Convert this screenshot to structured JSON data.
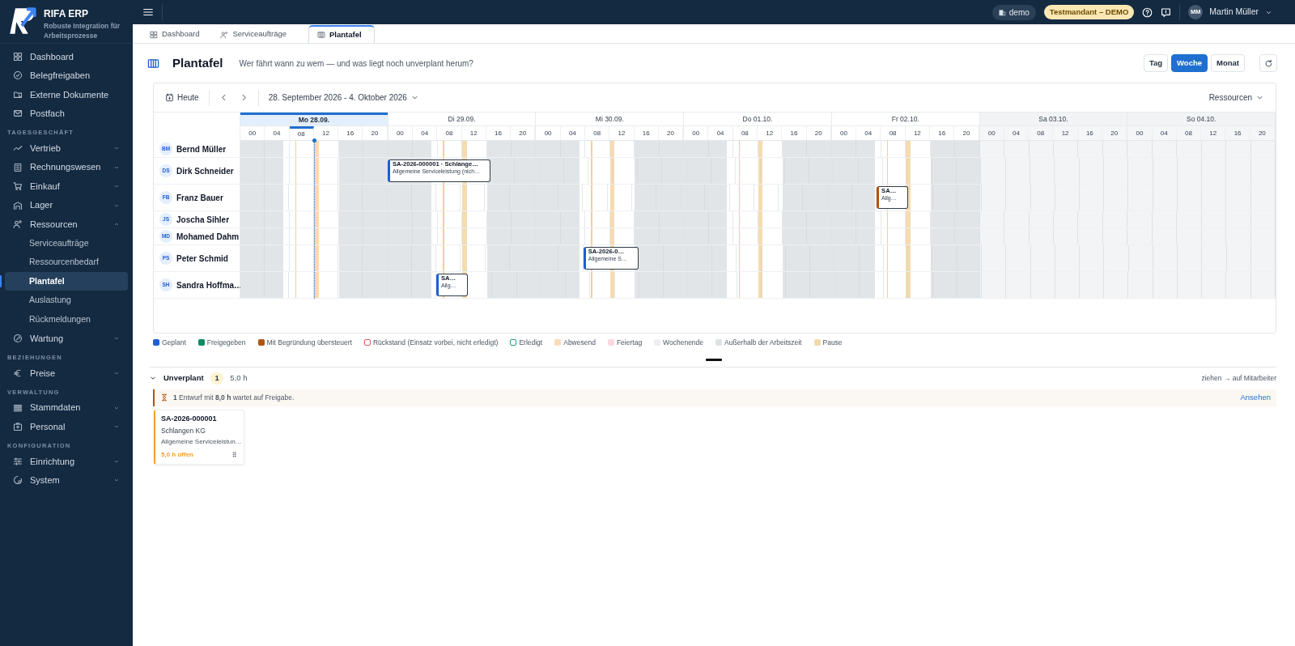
{
  "app": {
    "name": "RIFA ERP",
    "tagline": "Robuste Integration für Arbeitsprozesse"
  },
  "sidebar": {
    "sections": [
      {
        "items": [
          {
            "label": "Dashboard",
            "selected": false
          },
          {
            "label": "Belegfreigaben",
            "selected": false
          },
          {
            "label": "Externe Dokumente",
            "selected": false
          },
          {
            "label": "Postfach",
            "selected": false
          }
        ]
      },
      {
        "heading": "TAGESGESCHÄFT",
        "items": [
          {
            "label": "Vertrieb",
            "selected": false,
            "expanded": false
          },
          {
            "label": "Rechnungswesen",
            "selected": false,
            "expanded": false
          },
          {
            "label": "Einkauf",
            "selected": false,
            "expanded": false
          },
          {
            "label": "Lager",
            "selected": false,
            "expanded": false
          },
          {
            "label": "Ressourcen",
            "selected": false,
            "expanded": true,
            "children": [
              {
                "label": "Serviceaufträge",
                "selected": false
              },
              {
                "label": "Ressourcenbedarf",
                "selected": false
              },
              {
                "label": "Plantafel",
                "selected": true
              },
              {
                "label": "Auslastung",
                "selected": false
              },
              {
                "label": "Rückmeldungen",
                "selected": false
              }
            ]
          },
          {
            "label": "Wartung",
            "selected": false,
            "expanded": false
          }
        ]
      },
      {
        "heading": "BEZIEHUNGEN",
        "items": [
          {
            "label": "Preise",
            "selected": false,
            "expanded": false
          }
        ]
      },
      {
        "heading": "VERWALTUNG",
        "items": [
          {
            "label": "Stammdaten",
            "selected": false,
            "expanded": false
          },
          {
            "label": "Personal",
            "selected": false,
            "expanded": false
          }
        ]
      },
      {
        "heading": "KONFIGURATION",
        "items": [
          {
            "label": "Einrichtung",
            "selected": false,
            "expanded": false
          },
          {
            "label": "System",
            "selected": false,
            "expanded": false
          }
        ]
      }
    ]
  },
  "topbar": {
    "workspace": "demo",
    "tenant": "Testmandant – DEMO",
    "user": {
      "initials": "MM",
      "name": "Martin Müller"
    }
  },
  "tabs": [
    {
      "label": "Dashboard",
      "selected": false
    },
    {
      "label": "Serviceaufträge",
      "selected": false
    },
    {
      "label": "Plantafel",
      "selected": true
    }
  ],
  "page": {
    "title": "Plantafel",
    "subtitle": "Wer fährt wann zu wem — und was liegt noch unverplant herum?",
    "views": [
      {
        "label": "Tag",
        "selected": false
      },
      {
        "label": "Woche",
        "selected": true
      },
      {
        "label": "Monat",
        "selected": false
      }
    ]
  },
  "planner": {
    "today_button": "Heute",
    "range": "28. September 2026 - 4. Oktober 2026",
    "resources_menu": "Ressourcen",
    "days": [
      {
        "label": "Mo 28.09.",
        "kind": "workday",
        "today": true,
        "hours": [
          {
            "label": "00",
            "current": false
          },
          {
            "label": "04",
            "current": false
          },
          {
            "label": "08",
            "current": true
          },
          {
            "label": "12",
            "current": false
          },
          {
            "label": "16",
            "current": false
          },
          {
            "label": "20",
            "current": false
          }
        ]
      },
      {
        "label": "Di 29.09.",
        "kind": "workday",
        "today": false,
        "hours": [
          {
            "label": "00",
            "current": false
          },
          {
            "label": "04",
            "current": false
          },
          {
            "label": "08",
            "current": false
          },
          {
            "label": "12",
            "current": false
          },
          {
            "label": "16",
            "current": false
          },
          {
            "label": "20",
            "current": false
          }
        ]
      },
      {
        "label": "Mi 30.09.",
        "kind": "workday",
        "today": false,
        "hours": [
          {
            "label": "00",
            "current": false
          },
          {
            "label": "04",
            "current": false
          },
          {
            "label": "08",
            "current": false
          },
          {
            "label": "12",
            "current": false
          },
          {
            "label": "16",
            "current": false
          },
          {
            "label": "20",
            "current": false
          }
        ]
      },
      {
        "label": "Do 01.10.",
        "kind": "workday",
        "today": false,
        "hours": [
          {
            "label": "00",
            "current": false
          },
          {
            "label": "04",
            "current": false
          },
          {
            "label": "08",
            "current": false
          },
          {
            "label": "12",
            "current": false
          },
          {
            "label": "16",
            "current": false
          },
          {
            "label": "20",
            "current": false
          }
        ]
      },
      {
        "label": "Fr 02.10.",
        "kind": "workday",
        "today": false,
        "hours": [
          {
            "label": "00",
            "current": false
          },
          {
            "label": "04",
            "current": false
          },
          {
            "label": "08",
            "current": false
          },
          {
            "label": "12",
            "current": false
          },
          {
            "label": "16",
            "current": false
          },
          {
            "label": "20",
            "current": false
          }
        ]
      },
      {
        "label": "Sa 03.10.",
        "kind": "weekend",
        "today": false,
        "hours": [
          {
            "label": "00",
            "current": false
          },
          {
            "label": "04",
            "current": false
          },
          {
            "label": "08",
            "current": false
          },
          {
            "label": "12",
            "current": false
          },
          {
            "label": "16",
            "current": false
          },
          {
            "label": "20",
            "current": false
          }
        ]
      },
      {
        "label": "So 04.10.",
        "kind": "weekend",
        "today": false,
        "hours": [
          {
            "label": "00",
            "current": false
          },
          {
            "label": "04",
            "current": false
          },
          {
            "label": "08",
            "current": false
          },
          {
            "label": "12",
            "current": false
          },
          {
            "label": "16",
            "current": false
          },
          {
            "label": "20",
            "current": false
          }
        ]
      }
    ],
    "resources": [
      {
        "initials": "BM",
        "name": "Bernd Müller"
      },
      {
        "initials": "DS",
        "name": "Dirk Schneider",
        "events": [
          {
            "title": "SA-2026-000001 · Schlange…",
            "subtitle": "Allgemeine Serviceleistung (nich…",
            "kind": "planned",
            "slots": [
              false,
              false,
              false,
              false,
              false,
              false,
              true,
              true,
              true,
              true,
              false,
              false,
              false,
              false,
              false,
              false,
              false,
              false,
              false,
              false,
              false,
              false,
              false,
              false,
              false,
              false,
              false,
              false,
              false,
              false,
              false,
              false,
              false,
              false,
              false,
              false,
              false,
              false,
              false,
              false,
              false,
              false
            ]
          }
        ]
      },
      {
        "initials": "FB",
        "name": "Franz Bauer",
        "events": [
          {
            "title": "SA…",
            "subtitle": "Allg…",
            "kind": "overridden",
            "slots": [
              false,
              false,
              false,
              false,
              false,
              false,
              false,
              false,
              false,
              false,
              false,
              false,
              false,
              false,
              false,
              false,
              false,
              false,
              false,
              false,
              false,
              false,
              false,
              false,
              false,
              false,
              true,
              false,
              false,
              false,
              false,
              false,
              false,
              false,
              false,
              false,
              false,
              false,
              false,
              false,
              false,
              false
            ]
          }
        ]
      },
      {
        "initials": "JS",
        "name": "Joscha Sihler"
      },
      {
        "initials": "MD",
        "name": "Mohamed Dahm"
      },
      {
        "initials": "PS",
        "name": "Peter Schmid",
        "events": [
          {
            "title": "SA-2026-0…",
            "subtitle": "Allgemeine S…",
            "kind": "planned",
            "slots": [
              false,
              false,
              false,
              false,
              false,
              false,
              false,
              false,
              false,
              false,
              false,
              false,
              false,
              false,
              true,
              true,
              false,
              false,
              false,
              false,
              false,
              false,
              false,
              false,
              false,
              false,
              false,
              false,
              false,
              false,
              false,
              false,
              false,
              false,
              false,
              false,
              false,
              false,
              false,
              false,
              false,
              false
            ]
          }
        ]
      },
      {
        "initials": "SH",
        "name": "Sandra Hoffma…",
        "events": [
          {
            "title": "SA…",
            "subtitle": "Allg…",
            "kind": "planned",
            "slots": [
              false,
              false,
              false,
              false,
              false,
              false,
              false,
              false,
              true,
              false,
              false,
              false,
              false,
              false,
              false,
              false,
              false,
              false,
              false,
              false,
              false,
              false,
              false,
              false,
              false,
              false,
              false,
              false,
              false,
              false,
              false,
              false,
              false,
              false,
              false,
              false,
              false,
              false,
              false,
              false,
              false,
              false
            ]
          }
        ]
      }
    ]
  },
  "legend": [
    {
      "label": "Geplant",
      "color": "#1d5fd3",
      "kind": "filled"
    },
    {
      "label": "Freigegeben",
      "color": "#0e8a62",
      "kind": "filled"
    },
    {
      "label": "Mit Begründung übersteuert",
      "color": "#b4530f",
      "kind": "filled"
    },
    {
      "label": "Rückstand (Einsatz vorbei, nicht erledigt)",
      "color": "#e05a5a",
      "kind": "outline"
    },
    {
      "label": "Erledigt",
      "color": "#22a06b",
      "kind": "outline"
    },
    {
      "label": "Abwesend",
      "color": "#f8dcb8",
      "kind": "filled"
    },
    {
      "label": "Feiertag",
      "color": "#f9d7df",
      "kind": "filled"
    },
    {
      "label": "Wochenende",
      "color": "#eceef0",
      "kind": "filled"
    },
    {
      "label": "Außerhalb der Arbeitszeit",
      "color": "#dfe2e5",
      "kind": "filled"
    },
    {
      "label": "Pause",
      "color": "#f3d9ae",
      "kind": "filled"
    }
  ],
  "unplanned": {
    "title": "Unverplant",
    "expanded": true,
    "count": "1",
    "hours": "5,0 h",
    "hint": "ziehen → auf Mitarbeiter",
    "notice": "**1** Entwurf mit **8,0 h** wartet auf Freigabe.",
    "notice_link": "Ansehen",
    "cards": [
      {
        "number": "SA-2026-000001",
        "customer": "Schlangen KG",
        "description": "Allgemeine Serviceleistun…",
        "open": "5,0 h offen"
      }
    ]
  }
}
